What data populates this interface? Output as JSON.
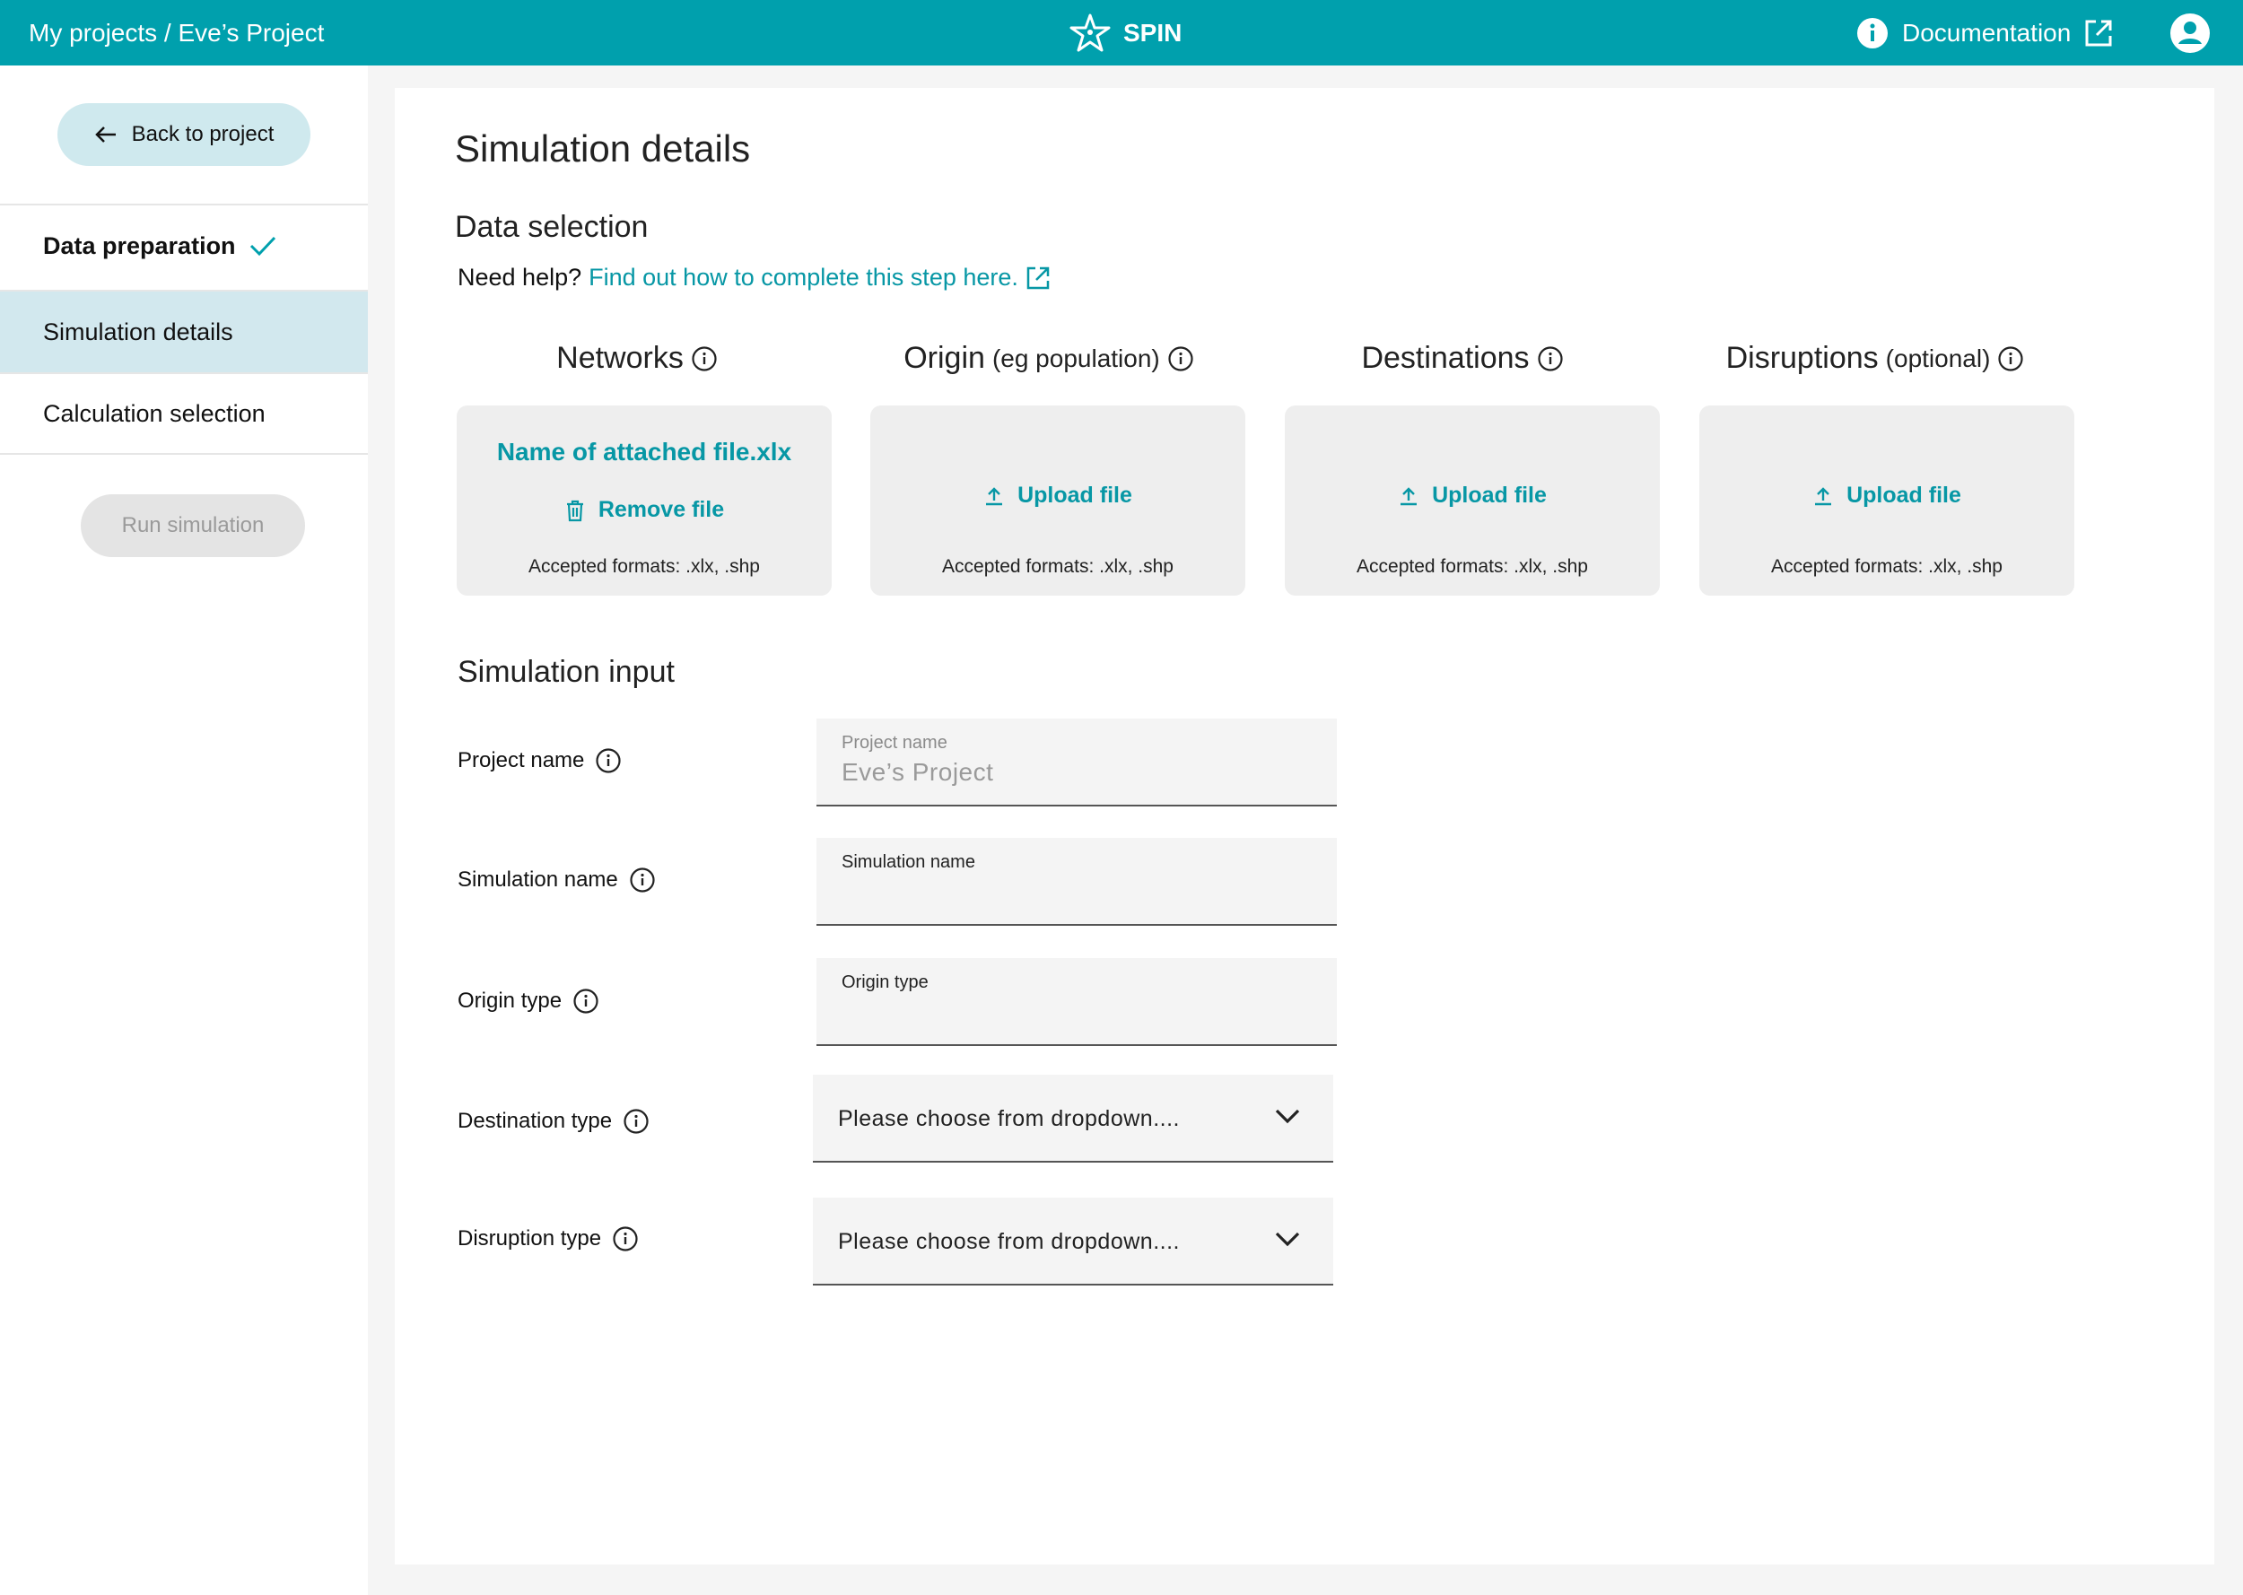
{
  "header": {
    "breadcrumb": "My projects / Eve’s Project",
    "brand": "SPIN",
    "documentation": "Documentation"
  },
  "colors": {
    "primary": "#00a0ad",
    "link": "#0797a5",
    "active_nav": "#d2e8ee"
  },
  "sidebar": {
    "back_label": "Back to project",
    "items": [
      {
        "label": "Data preparation",
        "state": "complete"
      },
      {
        "label": "Simulation details",
        "state": "active"
      },
      {
        "label": "Calculation selection",
        "state": "default"
      }
    ],
    "run_label": "Run simulation"
  },
  "main": {
    "title": "Simulation details",
    "data_selection_title": "Data selection",
    "help_prefix": "Need help?",
    "help_link": "Find out how to complete this step here.",
    "columns": [
      {
        "title": "Networks",
        "suffix": "",
        "file_name": "Name of attached file.xlx",
        "action": "Remove file",
        "formats": "Accepted formats: .xlx, .shp"
      },
      {
        "title": "Origin",
        "suffix": "(eg population)",
        "action": "Upload file",
        "formats": "Accepted formats: .xlx, .shp"
      },
      {
        "title": "Destinations",
        "suffix": "",
        "action": "Upload file",
        "formats": "Accepted formats: .xlx, .shp"
      },
      {
        "title": "Disruptions",
        "suffix": "(optional)",
        "action": "Upload file",
        "formats": "Accepted formats: .xlx, .shp"
      }
    ],
    "simulation_input_title": "Simulation input",
    "fields": [
      {
        "label": "Project name",
        "caption": "Project name",
        "value": "Eve’s Project"
      },
      {
        "label": "Simulation name",
        "caption": "Simulation name",
        "value": ""
      },
      {
        "label": "Origin type",
        "caption": "Origin type",
        "value": ""
      },
      {
        "label": "Destination type",
        "selected": "Please choose from dropdown...."
      },
      {
        "label": "Disruption type",
        "selected": "Please choose from dropdown...."
      }
    ]
  }
}
